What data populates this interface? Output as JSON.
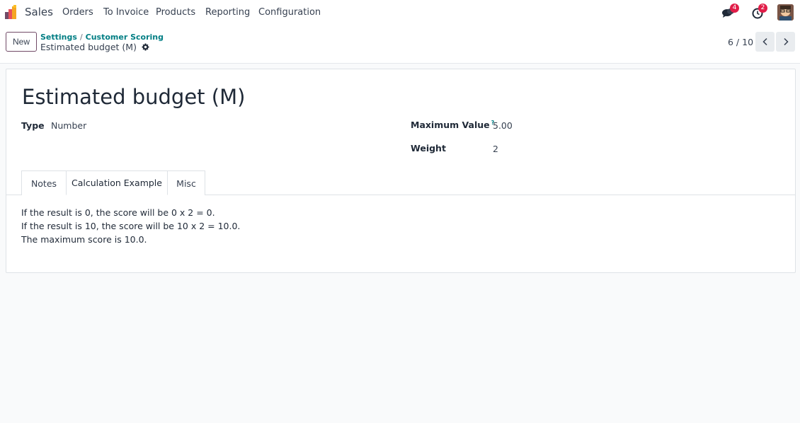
{
  "navbar": {
    "app_name": "Sales",
    "menu": [
      "Orders",
      "To Invoice",
      "Products",
      "Reporting",
      "Configuration"
    ],
    "messages_count": "4",
    "activities_count": "2"
  },
  "control_panel": {
    "new_label": "New",
    "breadcrumb": [
      "Settings",
      "Customer Scoring"
    ],
    "breadcrumb_sep": "/",
    "record_name": "Estimated budget (M)",
    "pager": "6 / 10"
  },
  "form": {
    "title": "Estimated budget (M)",
    "type_label": "Type",
    "type_value": "Number",
    "max_value_label": "Maximum Value",
    "max_value_help": "?",
    "max_value": "5.00",
    "weight_label": "Weight",
    "weight_value": "2"
  },
  "tabs": [
    "Notes",
    "Calculation Example",
    "Misc"
  ],
  "active_tab": "Calculation Example",
  "calculation_example": [
    "If the result is 0, the score will be 0 x 2 = 0.",
    "If the result is 10, the score will be 10 x 2 = 10.0.",
    "The maximum score is 10.0."
  ],
  "icons": {
    "logo": "sales-app-icon",
    "messages": "chat-bubbles-icon",
    "activities": "clock-icon",
    "gear": "gear-icon",
    "prev": "chevron-left-icon",
    "next": "chevron-right-icon"
  },
  "colors": {
    "primary": "#714b67",
    "link": "#017e84",
    "badge": "#e11d48"
  }
}
